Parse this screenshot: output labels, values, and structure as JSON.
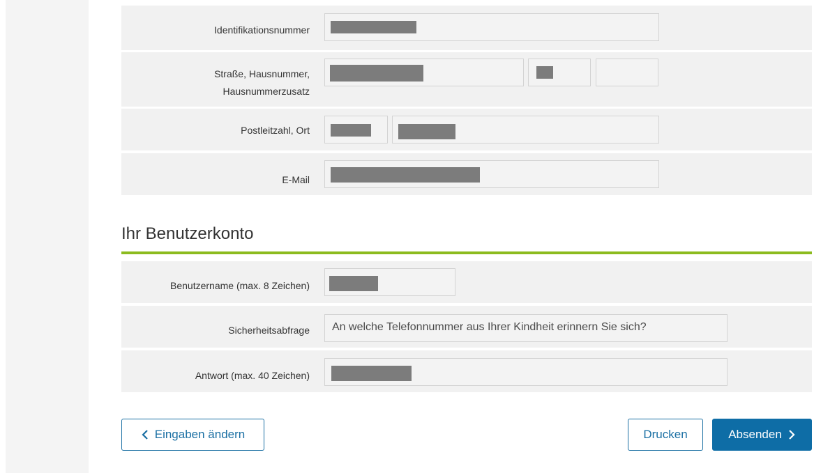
{
  "address": {
    "id_label": "Identifikationsnummer",
    "street_label_line1": "Straße,  Hausnummer,",
    "street_label_line2": "Hausnummerzusatz",
    "postal_label": "Postleitzahl,  Ort",
    "email_label": "E-Mail"
  },
  "account": {
    "section_title": "Ihr Benutzerkonto",
    "username_label": "Benutzername (max. 8 Zeichen)",
    "security_label": "Sicherheitsabfrage",
    "security_value": "An welche Telefonnummer aus Ihrer Kindheit erinnern Sie sich?",
    "answer_label": "Antwort (max. 40 Zeichen)"
  },
  "actions": {
    "back_label": "Eingaben ändern",
    "print_label": "Drucken",
    "submit_label": "Absenden"
  },
  "colors": {
    "accent_green": "#8cbb1f",
    "primary_blue": "#0e6da6",
    "redaction_gray": "#7c7c7c"
  },
  "icons": {
    "back": "chevron-left-icon",
    "submit": "chevron-right-icon"
  }
}
